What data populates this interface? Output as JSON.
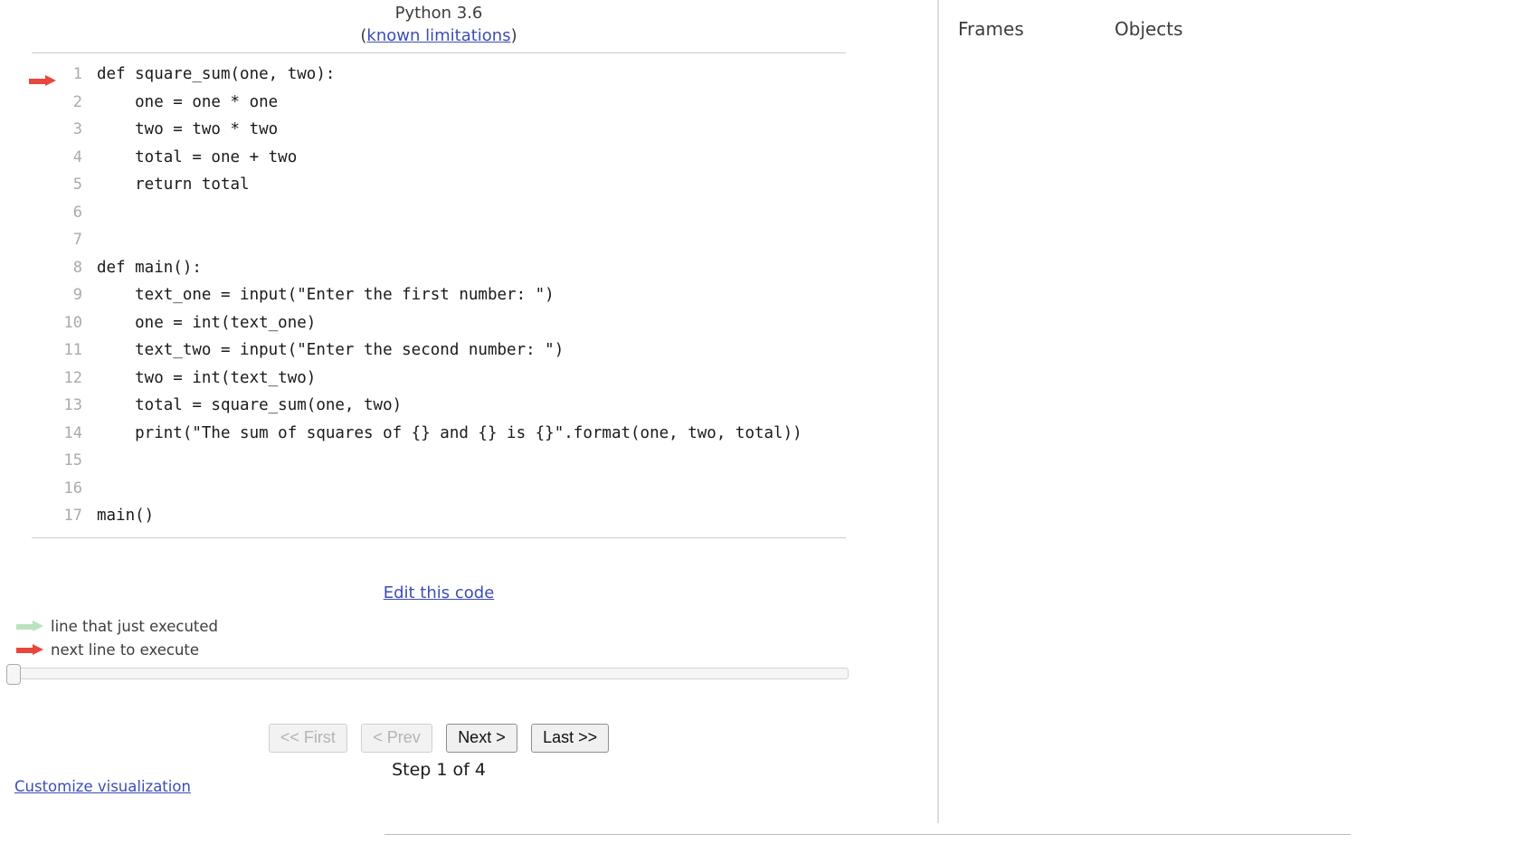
{
  "header": {
    "python_version": "Python 3.6",
    "limitations_prefix": "(",
    "limitations_link": "known limitations",
    "limitations_suffix": ")"
  },
  "colors": {
    "next_arrow": "#e8473c",
    "executed_arrow": "#b9e3bf",
    "link": "#3d4db7",
    "line_number": "#aaaaaa",
    "code_text": "#1a1a1a",
    "border": "#cccccc"
  },
  "code": {
    "lines": [
      {
        "number": "1",
        "text": "def square_sum(one, two):",
        "marker": "next"
      },
      {
        "number": "2",
        "text": "    one = one * one",
        "marker": "none"
      },
      {
        "number": "3",
        "text": "    two = two * two",
        "marker": "none"
      },
      {
        "number": "4",
        "text": "    total = one + two",
        "marker": "none"
      },
      {
        "number": "5",
        "text": "    return total",
        "marker": "none"
      },
      {
        "number": "6",
        "text": "",
        "marker": "none"
      },
      {
        "number": "7",
        "text": "",
        "marker": "none"
      },
      {
        "number": "8",
        "text": "def main():",
        "marker": "none"
      },
      {
        "number": "9",
        "text": "    text_one = input(\"Enter the first number: \")",
        "marker": "none"
      },
      {
        "number": "10",
        "text": "    one = int(text_one)",
        "marker": "none"
      },
      {
        "number": "11",
        "text": "    text_two = input(\"Enter the second number: \")",
        "marker": "none"
      },
      {
        "number": "12",
        "text": "    two = int(text_two)",
        "marker": "none"
      },
      {
        "number": "13",
        "text": "    total = square_sum(one, two)",
        "marker": "none"
      },
      {
        "number": "14",
        "text": "    print(\"The sum of squares of {} and {} is {}\".format(one, two, total))",
        "marker": "none"
      },
      {
        "number": "15",
        "text": "",
        "marker": "none"
      },
      {
        "number": "16",
        "text": "",
        "marker": "none"
      },
      {
        "number": "17",
        "text": "main()",
        "marker": "none"
      }
    ]
  },
  "edit_link": "Edit this code",
  "legend": {
    "executed": "line that just executed",
    "next": "next line to execute"
  },
  "nav": {
    "first": "<< First",
    "prev": "< Prev",
    "next": "Next >",
    "last": "Last >>",
    "step_label": "Step 1 of 4"
  },
  "customize_link": "Customize visualization",
  "right_pane": {
    "frames_heading": "Frames",
    "objects_heading": "Objects"
  }
}
